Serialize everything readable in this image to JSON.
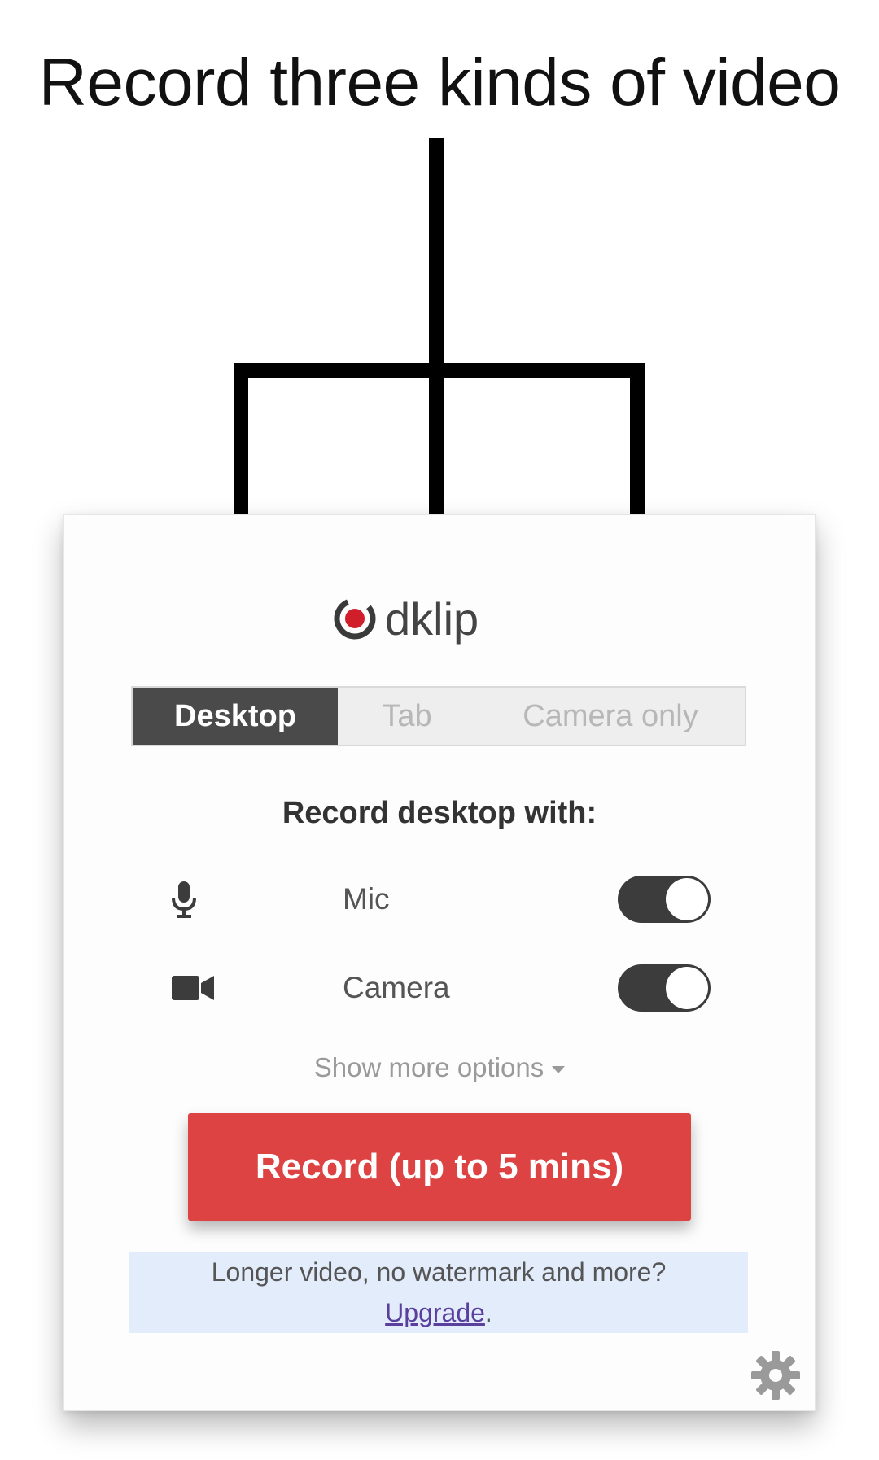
{
  "headline": "Record three kinds of video",
  "app": {
    "logo_text": "dklip"
  },
  "tabs": [
    {
      "label": "Desktop",
      "active": true
    },
    {
      "label": "Tab",
      "active": false
    },
    {
      "label": "Camera only",
      "active": false
    }
  ],
  "section_title": "Record desktop with:",
  "options": [
    {
      "label": "Mic",
      "icon": "mic-icon",
      "enabled": true
    },
    {
      "label": "Camera",
      "icon": "video-camera-icon",
      "enabled": true
    }
  ],
  "more_options_label": "Show more options",
  "record_button_label": "Record (up to 5 mins)",
  "promo": {
    "text": "Longer video, no watermark and more?",
    "link_label": "Upgrade",
    "suffix": "."
  },
  "colors": {
    "record_red": "#dc4342",
    "active_tab": "#4a4a4a",
    "promo_bg": "#e2ecfb",
    "logo_red": "#d01f2b"
  },
  "icons": {
    "settings": "gear-icon"
  }
}
